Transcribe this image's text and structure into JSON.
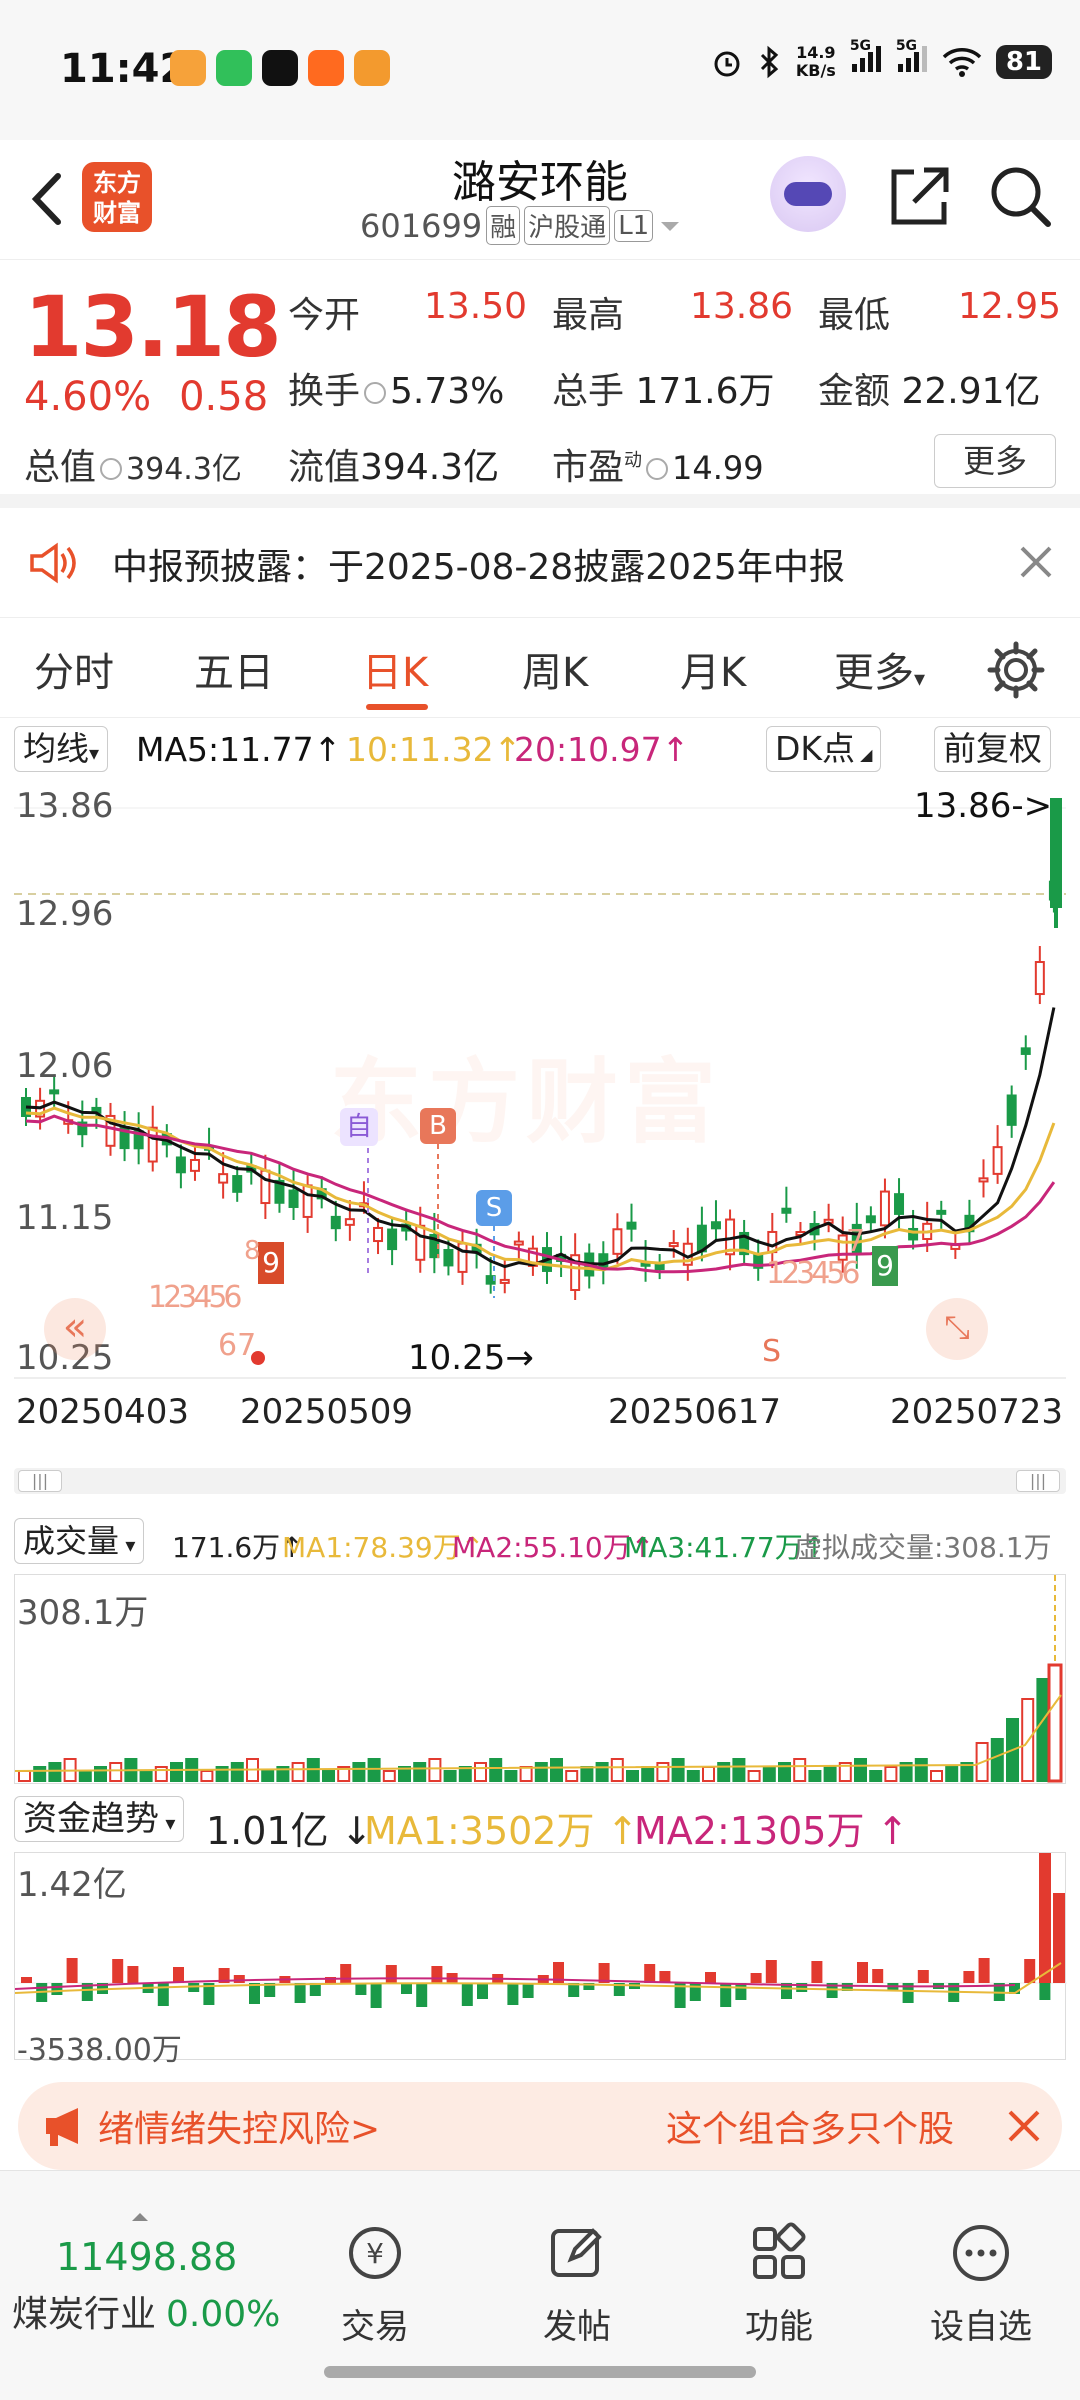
{
  "status": {
    "time": "11:42",
    "net_speed_value": "14.9",
    "net_speed_unit": "KB/s",
    "signal_label": "5G",
    "battery": "81"
  },
  "header": {
    "brand": "东方财富",
    "stock_name": "潞安环能",
    "stock_code": "601699",
    "tags": [
      "融",
      "沪股通",
      "L1"
    ]
  },
  "quote": {
    "price": "13.18",
    "change_pct": "4.60%",
    "change_abs": "0.58",
    "cells": {
      "open_label": "今开",
      "open_value": "13.50",
      "high_label": "最高",
      "high_value": "13.86",
      "low_label": "最低",
      "low_value": "12.95",
      "turnover_label": "换手",
      "turnover_value": "5.73%",
      "volume_label": "总手",
      "volume_value": "171.6万",
      "amount_label": "金额",
      "amount_value": "22.91亿",
      "mktcap_label": "总值",
      "mktcap_value": "394.3亿",
      "float_label": "流值",
      "float_value": "394.3亿",
      "pe_label": "市盈",
      "pe_sup": "动",
      "pe_value": "14.99"
    },
    "more_label": "更多"
  },
  "notice": {
    "text": "中报预披露：于2025-08-28披露2025年中报"
  },
  "tabs": {
    "items": [
      "分时",
      "五日",
      "日K",
      "周K",
      "月K",
      "更多"
    ],
    "active": "日K"
  },
  "ma": {
    "selector": "均线",
    "ma5": "MA5:11.77",
    "ma10": "10:11.32",
    "ma20": "20:10.97",
    "arrow_up": "↑",
    "dk_label": "DK点",
    "adjust_label": "前复权",
    "colors": {
      "ma5": "#111111",
      "ma10": "#e8b93a",
      "ma20": "#c8267a"
    }
  },
  "kline": {
    "price_labels": [
      "13.86",
      "12.96",
      "12.06",
      "11.15",
      "10.25"
    ],
    "date_labels": [
      "20250403",
      "20250509",
      "20250617",
      "20250723"
    ],
    "max_marker": "13.86->",
    "min_marker": "10.25",
    "signal_markers": {
      "zi": "自",
      "b": "B",
      "s": "S",
      "nine": "9",
      "eight": "8",
      "nine_green": "9",
      "seven": "7",
      "seq_down": "123456",
      "seq_down_end": "67",
      "seq_up": "123456",
      "s_bottom": "S"
    },
    "nav_left": "«",
    "watermark": "东方财富",
    "up_color": "#e23a2f",
    "down_color": "#1a9a48"
  },
  "volume": {
    "selector": "成交量",
    "value": "171.6万",
    "ma1": "MA1:78.39万",
    "ma2": "MA2:55.10万",
    "ma3": "MA3:41.77万",
    "virtual": "虚拟成交量:308.1万",
    "max_label": "308.1万",
    "arrow_up": "↑"
  },
  "fund": {
    "selector": "资金趋势",
    "value": "1.01亿",
    "arrow_down": "↓",
    "ma1": "MA1:3502万",
    "ma2": "MA2:1305万",
    "arrow_up": "↑",
    "max_label": "1.42亿",
    "min_label": "-3538.00万"
  },
  "banner": {
    "left_text": "绪情绪失控风险>",
    "right_text": "这个组合多只个股"
  },
  "bottom": {
    "index_value": "11498.88",
    "industry": "煤炭行业",
    "industry_change": "0.00%",
    "nav": [
      "交易",
      "发帖",
      "功能",
      "设自选"
    ],
    "trade_icon_symbol": "¥"
  }
}
